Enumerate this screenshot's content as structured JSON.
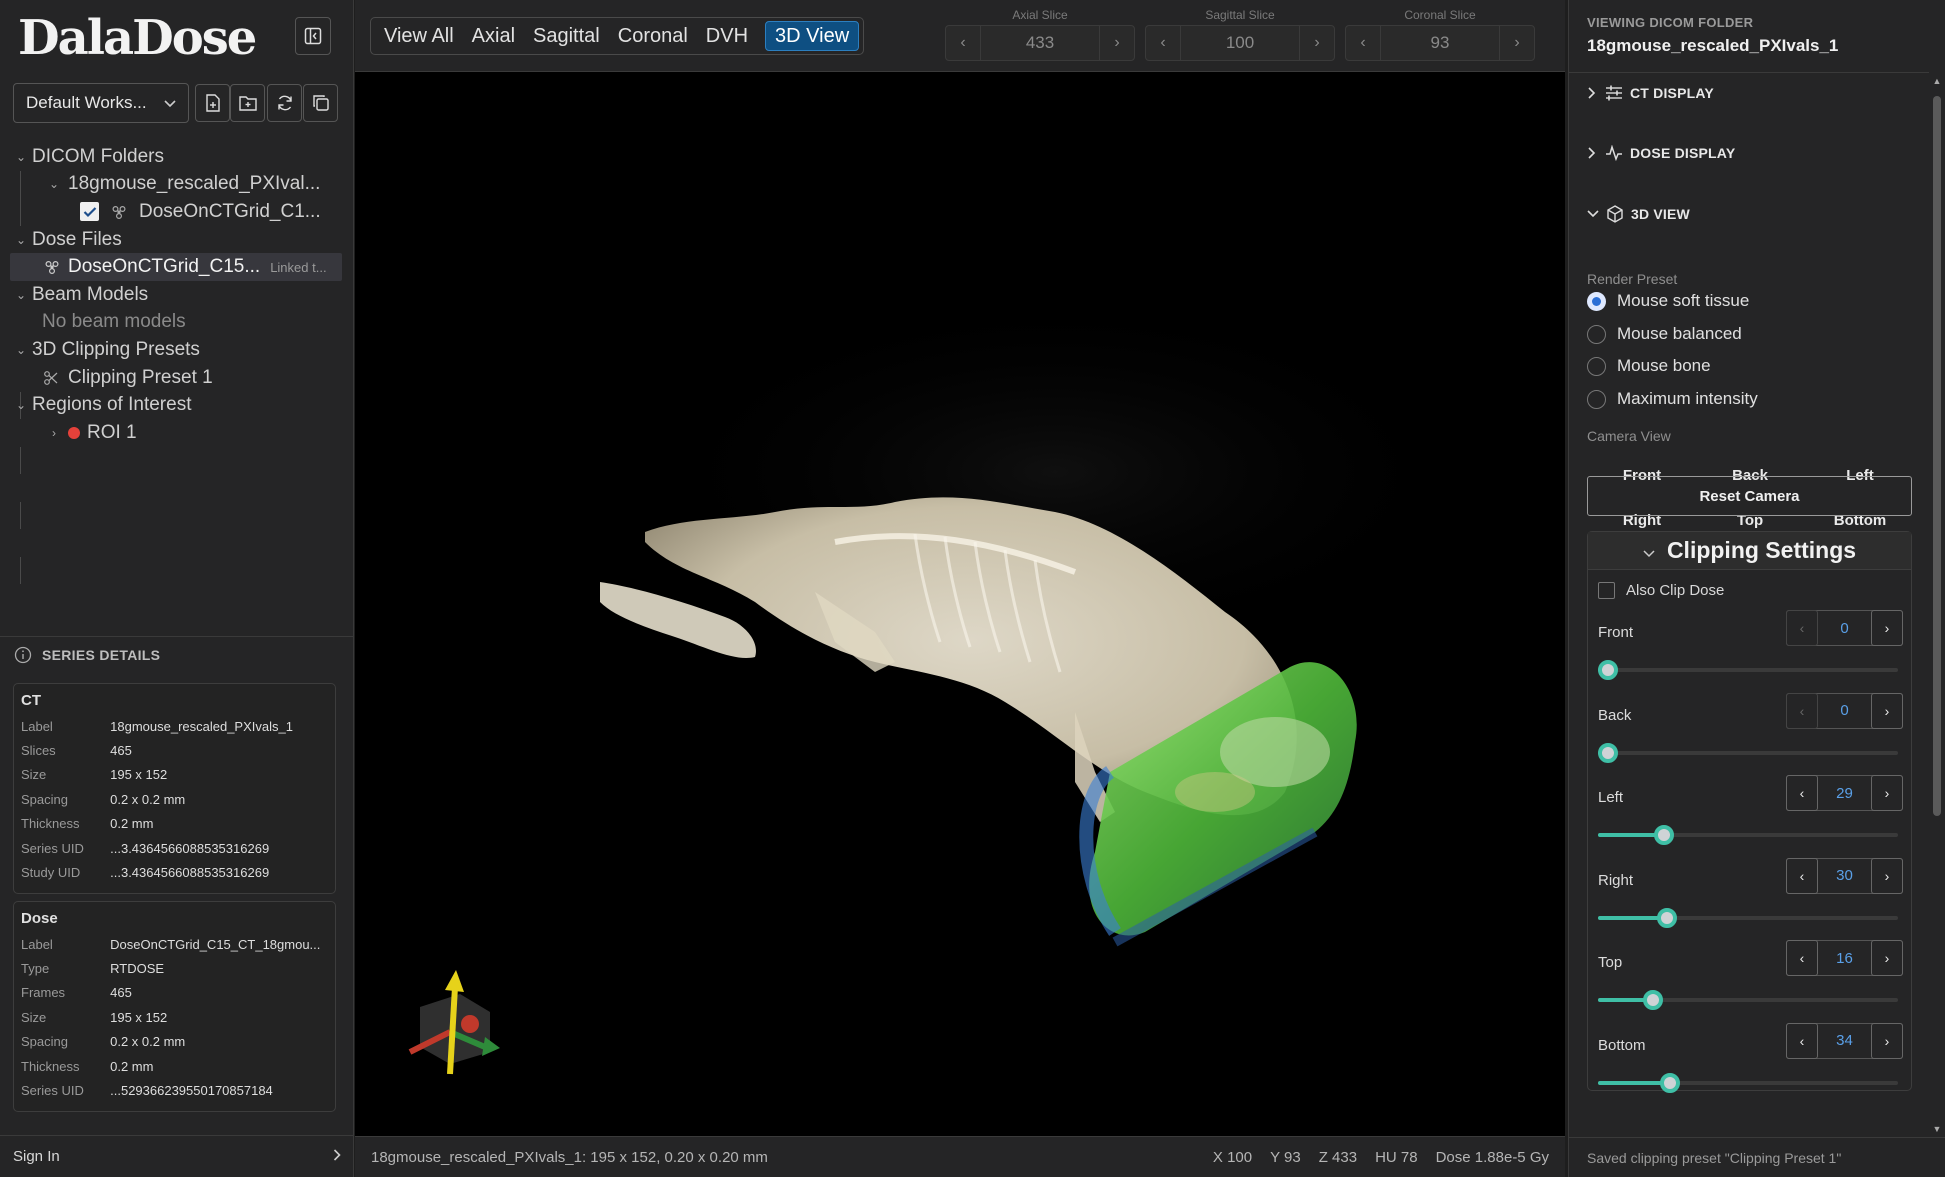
{
  "app": {
    "logo": "DalaDose"
  },
  "workspace": {
    "selected": "Default Works..."
  },
  "tree": {
    "dicom_folders": "DICOM Folders",
    "folder_name": "18gmouse_rescaled_PXIval...",
    "dicom_item": "DoseOnCTGrid_C1...",
    "dose_files": "Dose Files",
    "dose_file": "DoseOnCTGrid_C15...",
    "linked": "Linked t...",
    "beam_models": "Beam Models",
    "no_beam": "No beam models",
    "clipping_presets": "3D Clipping Presets",
    "clipping_preset_1": "Clipping Preset 1",
    "roi": "Regions of Interest",
    "roi_1": "ROI 1"
  },
  "series": {
    "heading": "SERIES DETAILS",
    "ct": {
      "title": "CT",
      "rows": [
        {
          "k": "Label",
          "v": "18gmouse_rescaled_PXIvals_1"
        },
        {
          "k": "Slices",
          "v": "465"
        },
        {
          "k": "Size",
          "v": "195 x 152"
        },
        {
          "k": "Spacing",
          "v": "0.2 x 0.2 mm"
        },
        {
          "k": "Thickness",
          "v": "0.2 mm"
        },
        {
          "k": "Series UID",
          "v": "...3.4364566088535316269"
        },
        {
          "k": "Study UID",
          "v": "...3.4364566088535316269"
        }
      ]
    },
    "dose": {
      "title": "Dose",
      "rows": [
        {
          "k": "Label",
          "v": "DoseOnCTGrid_C15_CT_18gmou..."
        },
        {
          "k": "Type",
          "v": "RTDOSE"
        },
        {
          "k": "Frames",
          "v": "465"
        },
        {
          "k": "Size",
          "v": "195 x 152"
        },
        {
          "k": "Spacing",
          "v": "0.2 x 0.2 mm"
        },
        {
          "k": "Thickness",
          "v": "0.2 mm"
        },
        {
          "k": "Series UID",
          "v": "...529366239550170857184"
        }
      ]
    }
  },
  "signin": "Sign In",
  "tabs": [
    "View All",
    "Axial",
    "Sagittal",
    "Coronal",
    "DVH",
    "3D View"
  ],
  "slices": {
    "axial": {
      "label": "Axial Slice",
      "value": "433"
    },
    "sagittal": {
      "label": "Sagittal Slice",
      "value": "100"
    },
    "coronal": {
      "label": "Coronal Slice",
      "value": "93"
    }
  },
  "status": {
    "left": "18gmouse_rescaled_PXIvals_1: 195 x 152, 0.20 x 0.20 mm",
    "x": "X 100",
    "y": "Y 93",
    "z": "Z 433",
    "hu": "HU 78",
    "dose": "Dose 1.88e-5 Gy"
  },
  "right": {
    "caption": "VIEWING DICOM FOLDER",
    "folder": "18gmouse_rescaled_PXIvals_1",
    "sections": {
      "ct": "CT DISPLAY",
      "dose": "DOSE DISPLAY",
      "view3d": "3D VIEW"
    },
    "render_preset_label": "Render Preset",
    "presets": [
      "Mouse soft tissue",
      "Mouse balanced",
      "Mouse bone",
      "Maximum intensity"
    ],
    "selected_preset": "Mouse soft tissue",
    "camera_label": "Camera View",
    "camera": [
      "Front",
      "Back",
      "Left",
      "Right",
      "Top",
      "Bottom"
    ],
    "reset": "Reset Camera",
    "clipping_title": "Clipping Settings",
    "also_clip": "Also Clip Dose",
    "clip": [
      {
        "name": "Front",
        "value": "0",
        "fraction": 0.0
      },
      {
        "name": "Back",
        "value": "0",
        "fraction": 0.0
      },
      {
        "name": "Left",
        "value": "29",
        "fraction": 0.2
      },
      {
        "name": "Right",
        "value": "30",
        "fraction": 0.21
      },
      {
        "name": "Top",
        "value": "16",
        "fraction": 0.16
      },
      {
        "name": "Bottom",
        "value": "34",
        "fraction": 0.22
      }
    ],
    "status": "Saved clipping preset \"Clipping Preset 1\""
  },
  "colors": {
    "accent": "#0e4f82",
    "slider": "#3fbfa6",
    "roi": "#e5413a",
    "dose_green": "#4fbf3a"
  }
}
